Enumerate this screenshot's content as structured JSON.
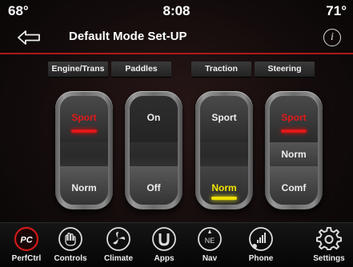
{
  "status": {
    "temp_left": "68°",
    "time": "8:08",
    "temp_right": "71°"
  },
  "header": {
    "title": "Default Mode Set-UP",
    "info_glyph": "i"
  },
  "tabs": [
    "Engine/Trans",
    "Paddles",
    "Traction",
    "Steering"
  ],
  "toggles": [
    {
      "name": "engine-trans",
      "top": "Sport",
      "middle": "",
      "bottom": "Norm",
      "selected": "Sport",
      "indicator": "red"
    },
    {
      "name": "paddles",
      "top": "On",
      "middle": "",
      "bottom": "Off",
      "selected": "",
      "indicator": ""
    },
    {
      "name": "traction",
      "top": "Sport",
      "middle": "",
      "bottom": "Norm",
      "selected": "Norm",
      "indicator": "yellow"
    },
    {
      "name": "steering",
      "top": "Sport",
      "middle": "Norm",
      "bottom": "Comf",
      "selected": "Sport",
      "indicator": "red"
    }
  ],
  "nav": [
    {
      "label": "PerfCtrl",
      "icon": "perf-control-icon"
    },
    {
      "label": "Controls",
      "icon": "controls-icon"
    },
    {
      "label": "Climate",
      "icon": "climate-icon"
    },
    {
      "label": "Apps",
      "icon": "apps-icon"
    },
    {
      "label": "Nav",
      "icon": "compass-icon"
    },
    {
      "label": "Phone",
      "icon": "phone-icon"
    },
    {
      "label": "Settings",
      "icon": "gear-icon"
    }
  ],
  "nav_glyphs": {
    "perfctrl": "PC",
    "nav": "NE"
  },
  "colors": {
    "accent_red": "#e01818",
    "accent_yellow": "#f0e000"
  }
}
